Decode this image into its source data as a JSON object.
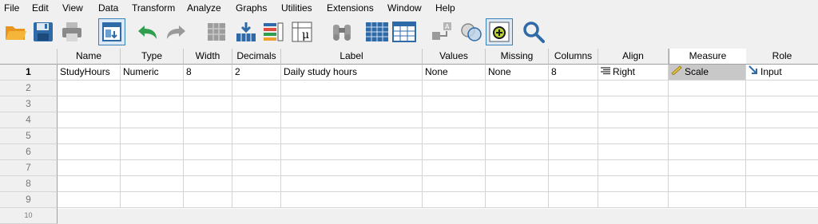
{
  "menu": [
    "File",
    "Edit",
    "View",
    "Data",
    "Transform",
    "Analyze",
    "Graphs",
    "Utilities",
    "Extensions",
    "Window",
    "Help"
  ],
  "toolbar": {
    "icons": [
      "open-folder-icon",
      "save-icon",
      "print-icon",
      "recall-dialog-icon",
      "undo-icon",
      "redo-icon",
      "goto-case-icon",
      "goto-variable-icon",
      "variables-icon",
      "run-descriptives-icon",
      "find-icon",
      "insert-cases-icon",
      "insert-variable-icon",
      "split-file-icon",
      "select-cases-icon",
      "value-labels-icon",
      "use-sets-icon",
      "search-icon"
    ]
  },
  "grid": {
    "columns": [
      "Name",
      "Type",
      "Width",
      "Decimals",
      "Label",
      "Values",
      "Missing",
      "Columns",
      "Align",
      "Measure",
      "Role"
    ],
    "row_numbers": [
      "1",
      "2",
      "3",
      "4",
      "5",
      "6",
      "7",
      "8",
      "9",
      "10"
    ],
    "rows": [
      {
        "name": "StudyHours",
        "type": "Numeric",
        "width": "8",
        "decimals": "2",
        "label": "Daily study hours",
        "values": "None",
        "missing": "None",
        "columns": "8",
        "align": "Right",
        "measure": "Scale",
        "role": "Input"
      }
    ]
  },
  "colors": {
    "accent": "#3c7fb1",
    "scale_bg": "#c8c8c8"
  }
}
